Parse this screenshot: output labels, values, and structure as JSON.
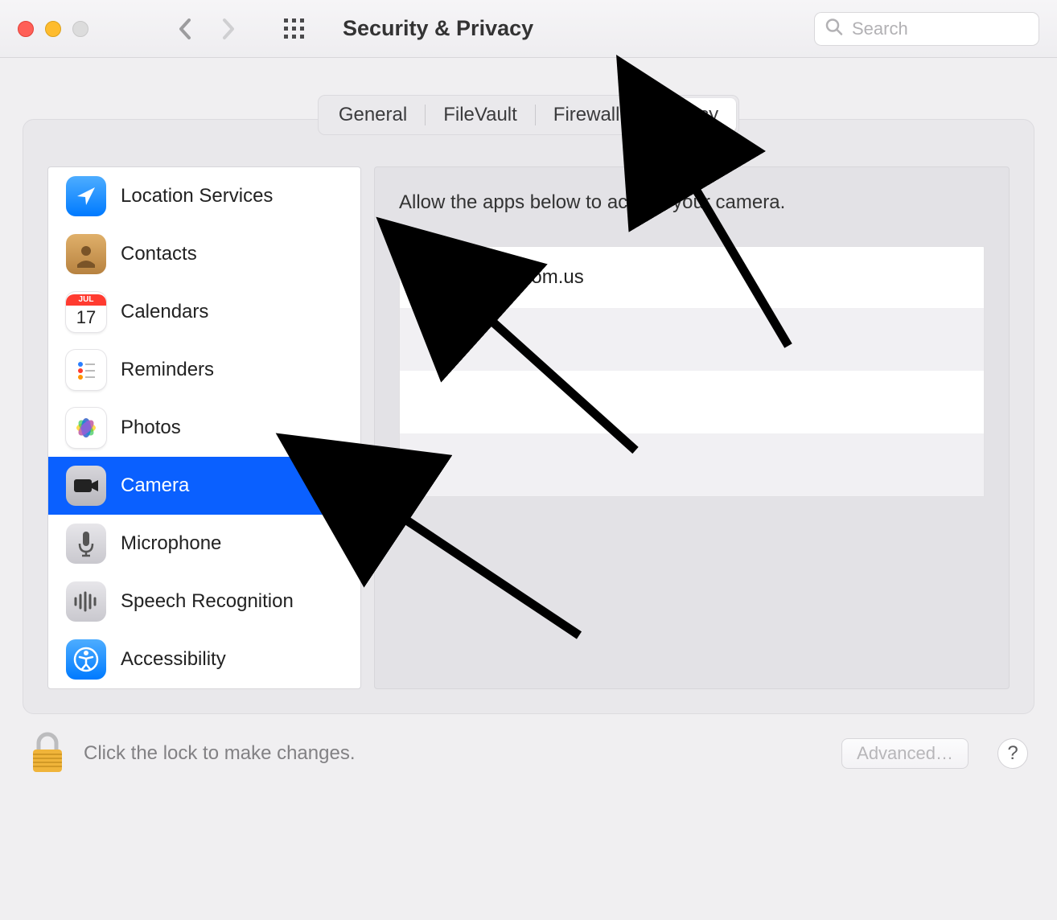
{
  "window": {
    "title": "Security & Privacy",
    "searchPlaceholder": "Search"
  },
  "tabs": {
    "items": [
      "General",
      "FileVault",
      "Firewall",
      "Privacy"
    ],
    "active": "Privacy"
  },
  "sidebar": {
    "items": [
      {
        "id": "location",
        "label": "Location Services"
      },
      {
        "id": "contacts",
        "label": "Contacts"
      },
      {
        "id": "calendars",
        "label": "Calendars"
      },
      {
        "id": "reminders",
        "label": "Reminders"
      },
      {
        "id": "photos",
        "label": "Photos"
      },
      {
        "id": "camera",
        "label": "Camera"
      },
      {
        "id": "microphone",
        "label": "Microphone"
      },
      {
        "id": "speech",
        "label": "Speech Recognition"
      },
      {
        "id": "accessibility",
        "label": "Accessibility"
      }
    ],
    "selected": "camera"
  },
  "content": {
    "heading": "Allow the apps below to access your camera.",
    "apps": [
      {
        "name": "zoom.us",
        "checked": true
      }
    ]
  },
  "footer": {
    "lockText": "Click the lock to make changes.",
    "advanced": "Advanced…",
    "help": "?"
  },
  "calendar": {
    "month": "JUL",
    "day": "17"
  }
}
